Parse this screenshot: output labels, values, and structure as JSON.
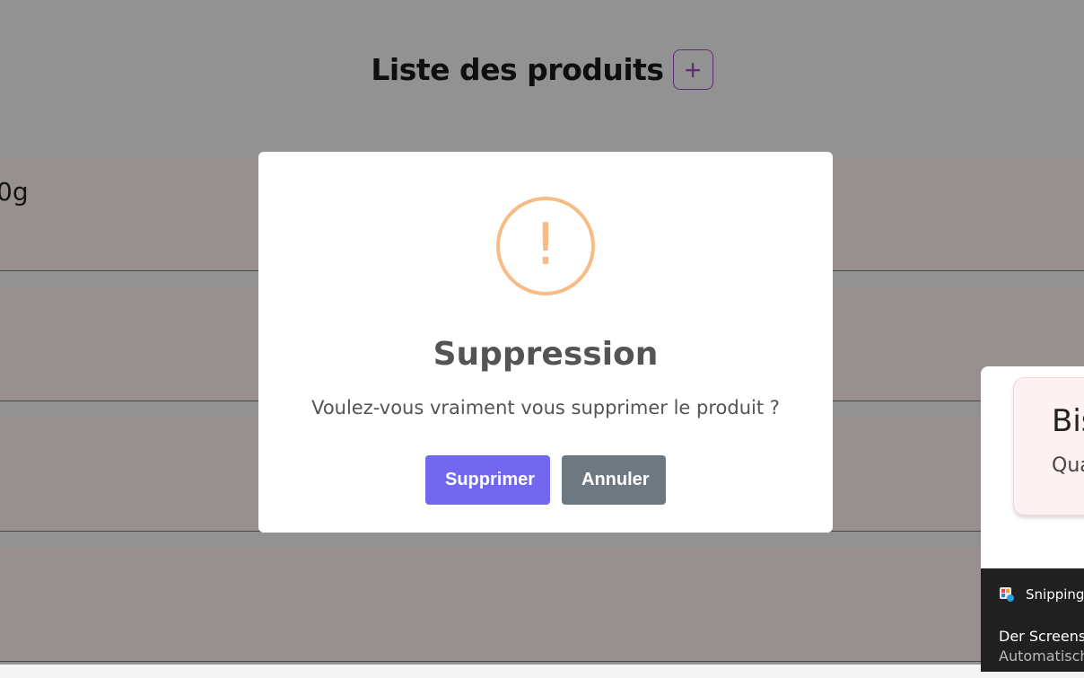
{
  "page": {
    "title": "Liste des produits",
    "add_symbol": "+",
    "rows": [
      {
        "text": "0g"
      },
      {
        "text": ""
      },
      {
        "text": ""
      },
      {
        "text": ""
      }
    ]
  },
  "modal": {
    "icon": "!",
    "title": "Suppression",
    "text": "Voulez-vous vraiment vous supprimer le produit ?",
    "confirm_label": "Supprimer",
    "cancel_label": "Annuler",
    "confirm_color": "#7367f0",
    "cancel_color": "#6e7881",
    "warning_color": "#f8bb86"
  },
  "toast": {
    "card_title": "Bis",
    "card_subtitle": "Qua",
    "app_label": "Snipping T",
    "message": "Der Screensh",
    "submessage": "Automatisch"
  }
}
